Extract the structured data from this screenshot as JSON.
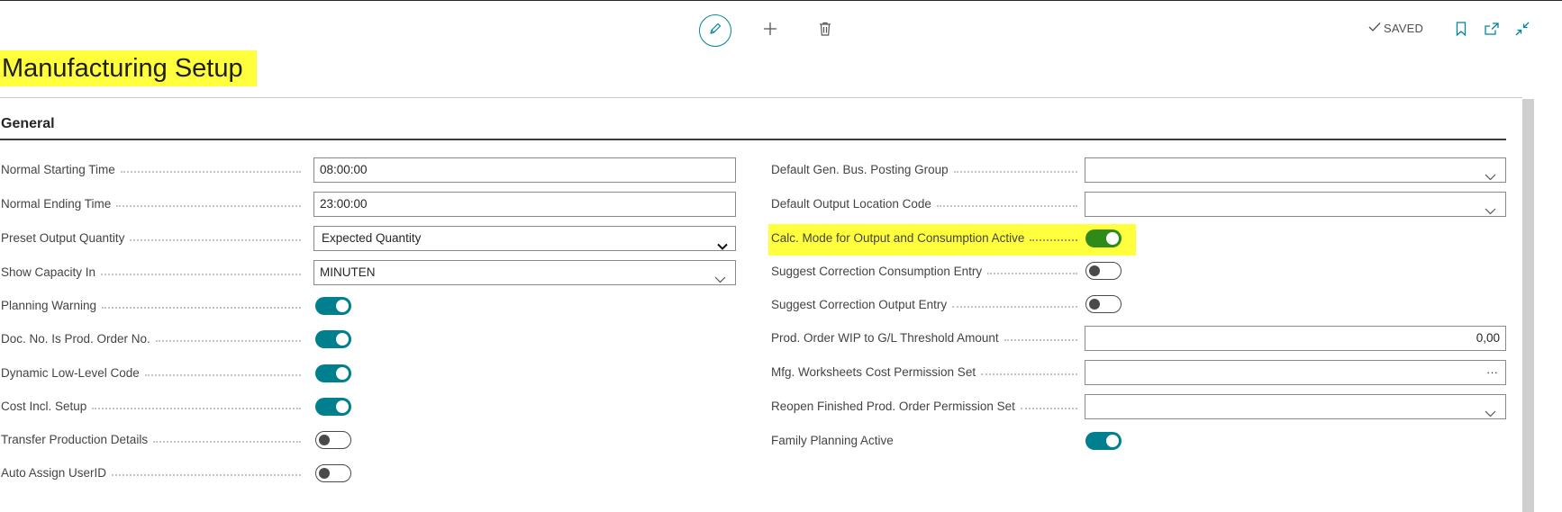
{
  "header": {
    "title": "Manufacturing Setup",
    "saved_label": "SAVED"
  },
  "toolbar": {
    "edit_icon": "pencil-icon",
    "new_icon": "plus-icon",
    "delete_icon": "trash-icon",
    "bookmark_icon": "bookmark-icon",
    "open_new_window_icon": "open-in-new-icon",
    "collapse_icon": "collapse-icon"
  },
  "section": {
    "title": "General"
  },
  "left_fields": [
    {
      "label": "Normal Starting Time",
      "type": "text",
      "value": "08:00:00"
    },
    {
      "label": "Normal Ending Time",
      "type": "text",
      "value": "23:00:00"
    },
    {
      "label": "Preset Output Quantity",
      "type": "select",
      "value": "Expected Quantity"
    },
    {
      "label": "Show Capacity In",
      "type": "lookup",
      "value": "MINUTEN"
    },
    {
      "label": "Planning Warning",
      "type": "toggle",
      "value": true
    },
    {
      "label": "Doc. No. Is Prod. Order No.",
      "type": "toggle",
      "value": true
    },
    {
      "label": "Dynamic Low-Level Code",
      "type": "toggle",
      "value": true
    },
    {
      "label": "Cost Incl. Setup",
      "type": "toggle",
      "value": true
    },
    {
      "label": "Transfer Production Details",
      "type": "toggle",
      "value": false
    },
    {
      "label": "Auto Assign UserID",
      "type": "toggle",
      "value": false
    }
  ],
  "right_fields": [
    {
      "label": "Default Gen. Bus. Posting Group",
      "type": "lookup",
      "value": ""
    },
    {
      "label": "Default Output Location Code",
      "type": "lookup",
      "value": ""
    },
    {
      "label": "Calc. Mode for Output and Consumption Active",
      "type": "toggle",
      "value": true
    },
    {
      "label": "Suggest Correction Consumption Entry",
      "type": "toggle",
      "value": false
    },
    {
      "label": "Suggest Correction Output Entry",
      "type": "toggle",
      "value": false
    },
    {
      "label": "Prod. Order WIP to G/L Threshold Amount",
      "type": "number",
      "value": "0,00"
    },
    {
      "label": "Mfg. Worksheets Cost Permission Set",
      "type": "assist",
      "value": "",
      "assist_label": "···"
    },
    {
      "label": "Reopen Finished Prod. Order Permission Set",
      "type": "lookup",
      "value": ""
    },
    {
      "label": "Family Planning Active",
      "type": "toggle",
      "value": true
    }
  ],
  "colors": {
    "accent": "#00808e",
    "highlight": "#ffff3d",
    "toggle_highlighted": "#2e8b1a"
  }
}
